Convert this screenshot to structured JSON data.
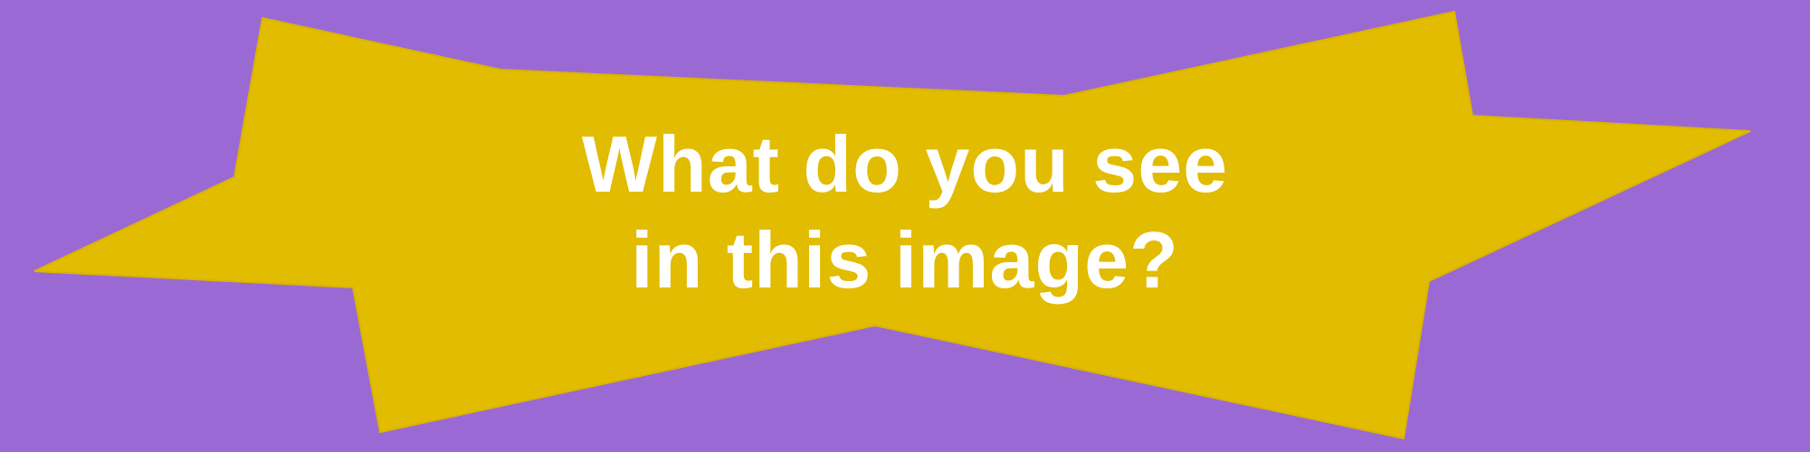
{
  "colors": {
    "background": "#9b69d4",
    "starburst": "#e2bc00",
    "text": "#ffffff"
  },
  "prompt": {
    "line1": "What do you see",
    "line2": "in this image?"
  }
}
